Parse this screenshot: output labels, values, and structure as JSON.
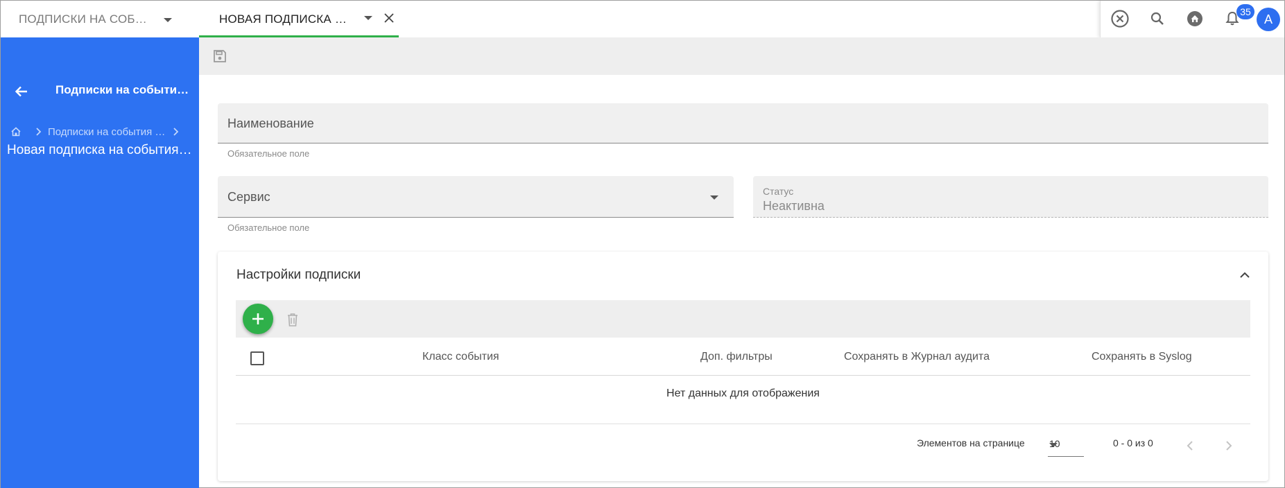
{
  "tabs": [
    {
      "label": "ПОДПИСКИ НА СОБЫТИЯ"
    },
    {
      "label": "НОВАЯ ПОДПИСКА НА СОБЫТИЯ"
    }
  ],
  "notifications": {
    "count": "35"
  },
  "user": {
    "avatar_letter": "A"
  },
  "sidebar": {
    "title": "Подписки на события аудита",
    "breadcrumb": "Подписки на события аудита",
    "current": "Новая подписка на события аудита"
  },
  "form": {
    "name": {
      "label": "Наименование",
      "hint": "Обязательное поле"
    },
    "service": {
      "label": "Сервис",
      "hint": "Обязательное поле"
    },
    "status": {
      "caption": "Статус",
      "value": "Неактивна"
    }
  },
  "settings": {
    "title": "Настройки подписки",
    "columns": [
      "Класс события",
      "Доп. фильтры",
      "Сохранять в Журнал аудита",
      "Сохранять в Syslog"
    ],
    "empty_text": "Нет данных для отображения",
    "paginator": {
      "items_per_page_label": "Элементов на странице",
      "page_size": "10",
      "range": "0 - 0 из 0"
    }
  },
  "colors": {
    "accent_blue": "#2d72f2",
    "accent_green": "#2fb04a",
    "toolbar_grey": "#eeeeee"
  }
}
